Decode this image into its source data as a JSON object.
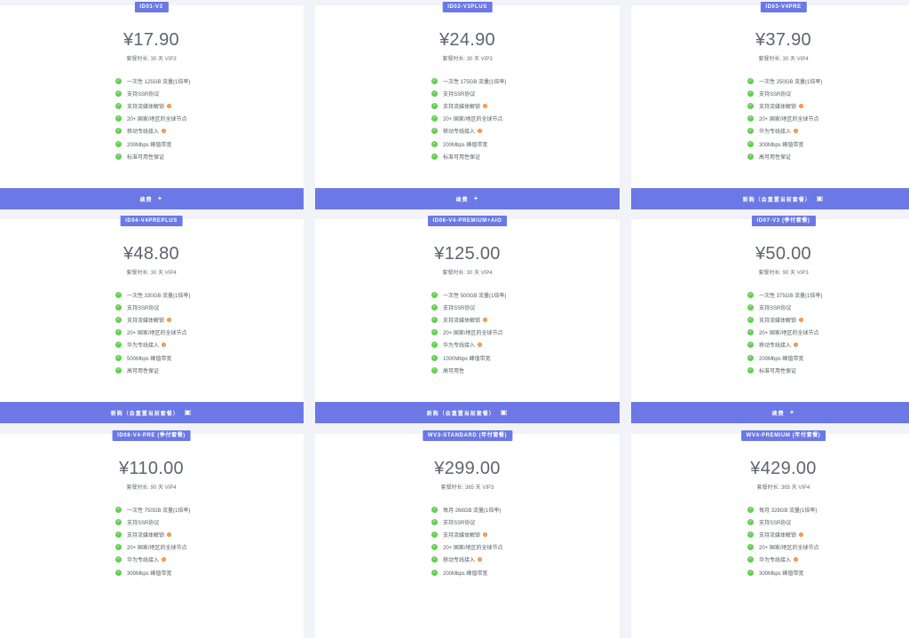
{
  "cards": [
    {
      "badge": "ID01-V3",
      "price": "¥17.90",
      "duration": "套餐时长: 30 天 VIP3",
      "features": [
        {
          "text": "一次性 125GB 流量(1倍率)",
          "help": false
        },
        {
          "text": "支持SSR协议",
          "help": false
        },
        {
          "text": "支持流媒体解锁",
          "help": true
        },
        {
          "text": "20+ 国家/地区的全球节点",
          "help": false
        },
        {
          "text": "移动专线接入",
          "help": true
        },
        {
          "text": "200Mbps 峰值带宽",
          "help": false
        },
        {
          "text": "标准可用性保证",
          "help": false
        }
      ],
      "button": {
        "label": "续费",
        "icon": "plus-icon",
        "glyph": "+"
      }
    },
    {
      "badge": "ID02-V3PLUS",
      "price": "¥24.90",
      "duration": "套餐时长: 30 天 VIP3",
      "features": [
        {
          "text": "一次性 175GB 流量(1倍率)",
          "help": false
        },
        {
          "text": "支持SSR协议",
          "help": false
        },
        {
          "text": "支持流媒体解锁",
          "help": true
        },
        {
          "text": "20+ 国家/地区的全球节点",
          "help": false
        },
        {
          "text": "移动专线接入",
          "help": true
        },
        {
          "text": "200Mbps 峰值带宽",
          "help": false
        },
        {
          "text": "标准可用性保证",
          "help": false
        }
      ],
      "button": {
        "label": "续费",
        "icon": "plus-icon",
        "glyph": "+"
      }
    },
    {
      "badge": "ID03-V4PRE",
      "price": "¥37.90",
      "duration": "套餐时长: 30 天 VIP4",
      "features": [
        {
          "text": "一次性 250GB 流量(1倍率)",
          "help": false
        },
        {
          "text": "支持SSR协议",
          "help": false
        },
        {
          "text": "支持流媒体解锁",
          "help": true
        },
        {
          "text": "20+ 国家/地区的全球节点",
          "help": false
        },
        {
          "text": "华为专线接入",
          "help": true
        },
        {
          "text": "300Mbps 峰值带宽",
          "help": false
        },
        {
          "text": "高可用性保证",
          "help": false
        }
      ],
      "button": {
        "label": "新购（会重置当前套餐）",
        "icon": "cart-icon",
        "glyph": "▣"
      }
    },
    {
      "badge": "ID04-V4PREPLUS",
      "price": "¥48.80",
      "duration": "套餐时长: 30 天 VIP4",
      "features": [
        {
          "text": "一次性 330GB 流量(1倍率)",
          "help": false
        },
        {
          "text": "支持SSR协议",
          "help": false
        },
        {
          "text": "支持流媒体解锁",
          "help": true
        },
        {
          "text": "20+ 国家/地区的全球节点",
          "help": false
        },
        {
          "text": "华为专线接入",
          "help": true
        },
        {
          "text": "500Mbps 峰值带宽",
          "help": false
        },
        {
          "text": "高可用性保证",
          "help": false
        }
      ],
      "button": {
        "label": "新购（会重置当前套餐）",
        "icon": "cart-icon",
        "glyph": "▣"
      }
    },
    {
      "badge": "ID06-V4-PREMIUM+AIO",
      "price": "¥125.00",
      "duration": "套餐时长: 30 天 VIP4",
      "features": [
        {
          "text": "一次性 500GB 流量(1倍率)",
          "help": false
        },
        {
          "text": "支持SSR协议",
          "help": false
        },
        {
          "text": "支持流媒体解锁",
          "help": true
        },
        {
          "text": "20+ 国家/地区的全球节点",
          "help": false
        },
        {
          "text": "华为专线接入",
          "help": true
        },
        {
          "text": "1000Mbps 峰值带宽",
          "help": false
        },
        {
          "text": "高可用性",
          "help": false
        }
      ],
      "button": {
        "label": "新购（会重置当前套餐）",
        "icon": "cart-icon",
        "glyph": "▣"
      }
    },
    {
      "badge": "ID07-V3 (季付套餐)",
      "price": "¥50.00",
      "duration": "套餐时长: 90 天 VIP3",
      "features": [
        {
          "text": "一次性 375GB 流量(1倍率)",
          "help": false
        },
        {
          "text": "支持SSR协议",
          "help": false
        },
        {
          "text": "支持流媒体解锁",
          "help": true
        },
        {
          "text": "20+ 国家/地区的全球节点",
          "help": false
        },
        {
          "text": "移动专线接入",
          "help": true
        },
        {
          "text": "200Mbps 峰值带宽",
          "help": false
        },
        {
          "text": "标准可用性保证",
          "help": false
        }
      ],
      "button": {
        "label": "续费",
        "icon": "plus-icon",
        "glyph": "+"
      }
    },
    {
      "badge": "ID08-V4-PRE (季付套餐)",
      "price": "¥110.00",
      "duration": "套餐时长: 90 天 VIP4",
      "features": [
        {
          "text": "一次性 750GB 流量(1倍率)",
          "help": false
        },
        {
          "text": "支持SSR协议",
          "help": false
        },
        {
          "text": "支持流媒体解锁",
          "help": true
        },
        {
          "text": "20+ 国家/地区的全球节点",
          "help": false
        },
        {
          "text": "华为专线接入",
          "help": true
        },
        {
          "text": "300Mbps 峰值带宽",
          "help": false
        }
      ],
      "button": null
    },
    {
      "badge": "WV3-STANDARD (年付套餐)",
      "price": "¥299.00",
      "duration": "套餐时长: 365 天 VIP3",
      "features": [
        {
          "text": "每月 268GB 流量(1倍率)",
          "help": false
        },
        {
          "text": "支持SSR协议",
          "help": false
        },
        {
          "text": "支持流媒体解锁",
          "help": true
        },
        {
          "text": "20+ 国家/地区的全球节点",
          "help": false
        },
        {
          "text": "移动专线接入",
          "help": true
        },
        {
          "text": "200Mbps 峰值带宽",
          "help": false
        }
      ],
      "button": null
    },
    {
      "badge": "WV4-PREMIUM (年付套餐)",
      "price": "¥429.00",
      "duration": "套餐时长: 365 天 VIP4",
      "features": [
        {
          "text": "每月 328GB 流量(1倍率)",
          "help": false
        },
        {
          "text": "支持SSR协议",
          "help": false
        },
        {
          "text": "支持流媒体解锁",
          "help": true
        },
        {
          "text": "20+ 国家/地区的全球节点",
          "help": false
        },
        {
          "text": "华为专线接入",
          "help": true
        },
        {
          "text": "300Mbps 峰值带宽",
          "help": false
        }
      ],
      "button": null
    }
  ],
  "icons": {
    "check": "check-icon",
    "help": "help-icon"
  },
  "colors": {
    "accent": "#6b78e5",
    "check": "#66cc55",
    "help": "#f28b3c",
    "background": "#f2f3f8"
  }
}
